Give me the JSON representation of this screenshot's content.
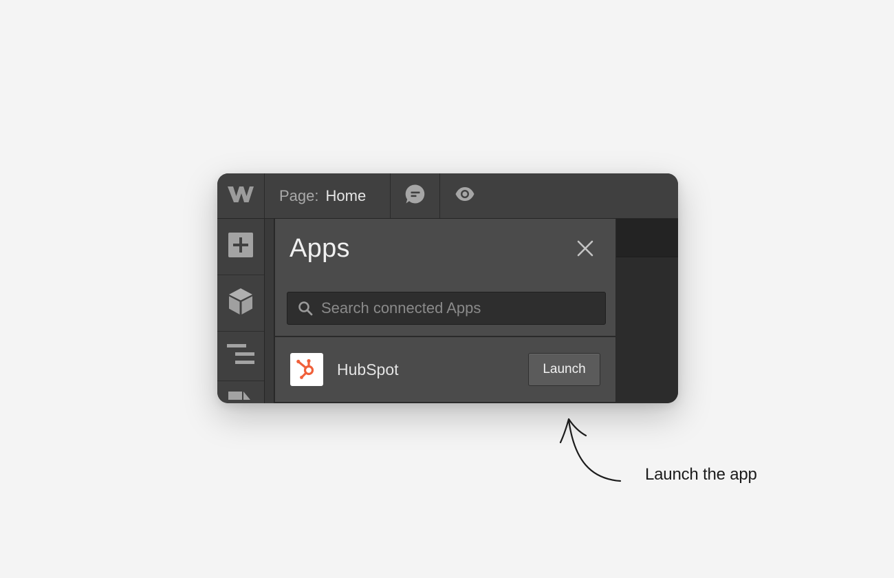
{
  "topbar": {
    "logo_icon": "webflow-logo-icon",
    "page_label": "Page:",
    "page_value": "Home",
    "comment_icon": "comment-icon",
    "preview_icon": "eye-icon"
  },
  "sidebar": {
    "items": [
      {
        "icon": "add-icon"
      },
      {
        "icon": "cube-icon"
      },
      {
        "icon": "navigator-icon"
      },
      {
        "icon": "pages-icon"
      }
    ]
  },
  "apps_panel": {
    "title": "Apps",
    "close_icon": "close-icon",
    "search": {
      "placeholder": "Search connected Apps",
      "value": ""
    },
    "apps": [
      {
        "name": "HubSpot",
        "icon": "hubspot-logo-icon",
        "action_label": "Launch"
      }
    ]
  },
  "annotation": {
    "text": "Launch the app"
  },
  "colors": {
    "background": "#f4f4f4",
    "topbar": "#404040",
    "panel": "#4b4b4b",
    "search_bg": "#2e2e2e",
    "hubspot_orange": "#f0603a"
  }
}
